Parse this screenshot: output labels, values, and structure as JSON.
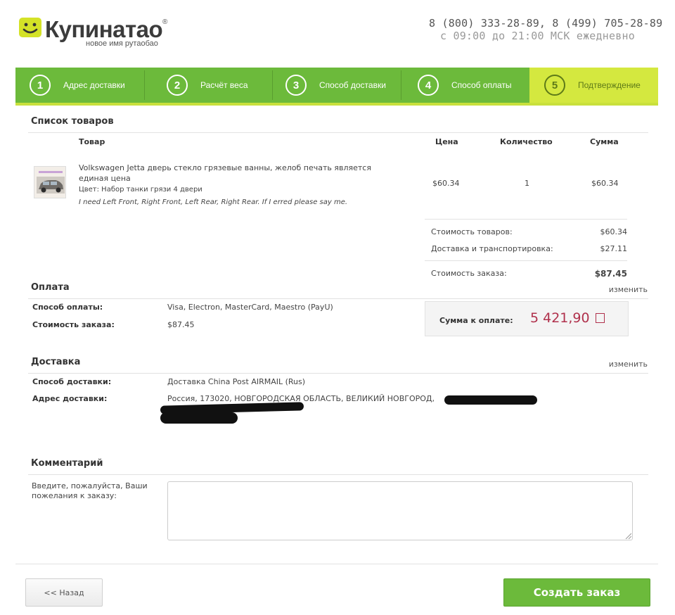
{
  "header": {
    "logo_name": "Купинатао",
    "logo_reg": "®",
    "logo_tagline": "новое имя рутаобао",
    "phones": "8 (800) 333-28-89, 8 (499) 705-28-89",
    "hours": "с 09:00 до 21:00 МСК ежедневно"
  },
  "steps": [
    {
      "num": "1",
      "label": "Адрес доставки"
    },
    {
      "num": "2",
      "label": "Расчёт веса"
    },
    {
      "num": "3",
      "label": "Способ доставки"
    },
    {
      "num": "4",
      "label": "Способ оплаты"
    },
    {
      "num": "5",
      "label": "Подтверждение",
      "active": true
    }
  ],
  "products": {
    "title": "Список товаров",
    "columns": {
      "item": "Товар",
      "price": "Цена",
      "qty": "Количество",
      "sum": "Сумма"
    },
    "items": [
      {
        "name": "Volkswagen Jetta дверь стекло грязевые ванны, желоб печать является единая цена",
        "color": "Цвет: Набор танки грязи 4 двери",
        "note": "I need Left Front, Right Front, Left Rear, Right Rear. If I erred please say me.",
        "price": "$60.34",
        "qty": "1",
        "sum": "$60.34"
      }
    ],
    "totals": {
      "goods_label": "Стоимость товаров:",
      "goods_value": "$60.34",
      "shipping_label": "Доставка и транспортировка:",
      "shipping_value": "$27.11",
      "order_label": "Стоимость заказа:",
      "order_value": "$87.45"
    }
  },
  "payment": {
    "title": "Оплата",
    "change": "изменить",
    "method_label": "Способ оплаты:",
    "method_value": "Visa, Electron, MasterCard, Maestro (PayU)",
    "cost_label": "Стоимость заказа:",
    "cost_value": "$87.45",
    "due_label": "Сумма к оплате:",
    "due_value": "5 421,90"
  },
  "delivery": {
    "title": "Доставка",
    "change": "изменить",
    "method_label": "Способ доставки:",
    "method_value": "Доставка China Post AIRMAIL (Rus)",
    "address_label": "Адрес доставки:",
    "address_value": "Россия, 173020, НОВГОРОДСКАЯ ОБЛАСТЬ, ВЕЛИКИЙ НОВГОРОД,"
  },
  "comment": {
    "title": "Комментарий",
    "label": "Введите, пожалуйста, Ваши пожелания к заказу:",
    "value": ""
  },
  "buttons": {
    "back": "<< Назад",
    "create": "Создать заказ"
  },
  "colors": {
    "green": "#6cba3b",
    "yellow": "#d4e83f",
    "due_amount": "#b0314c"
  }
}
